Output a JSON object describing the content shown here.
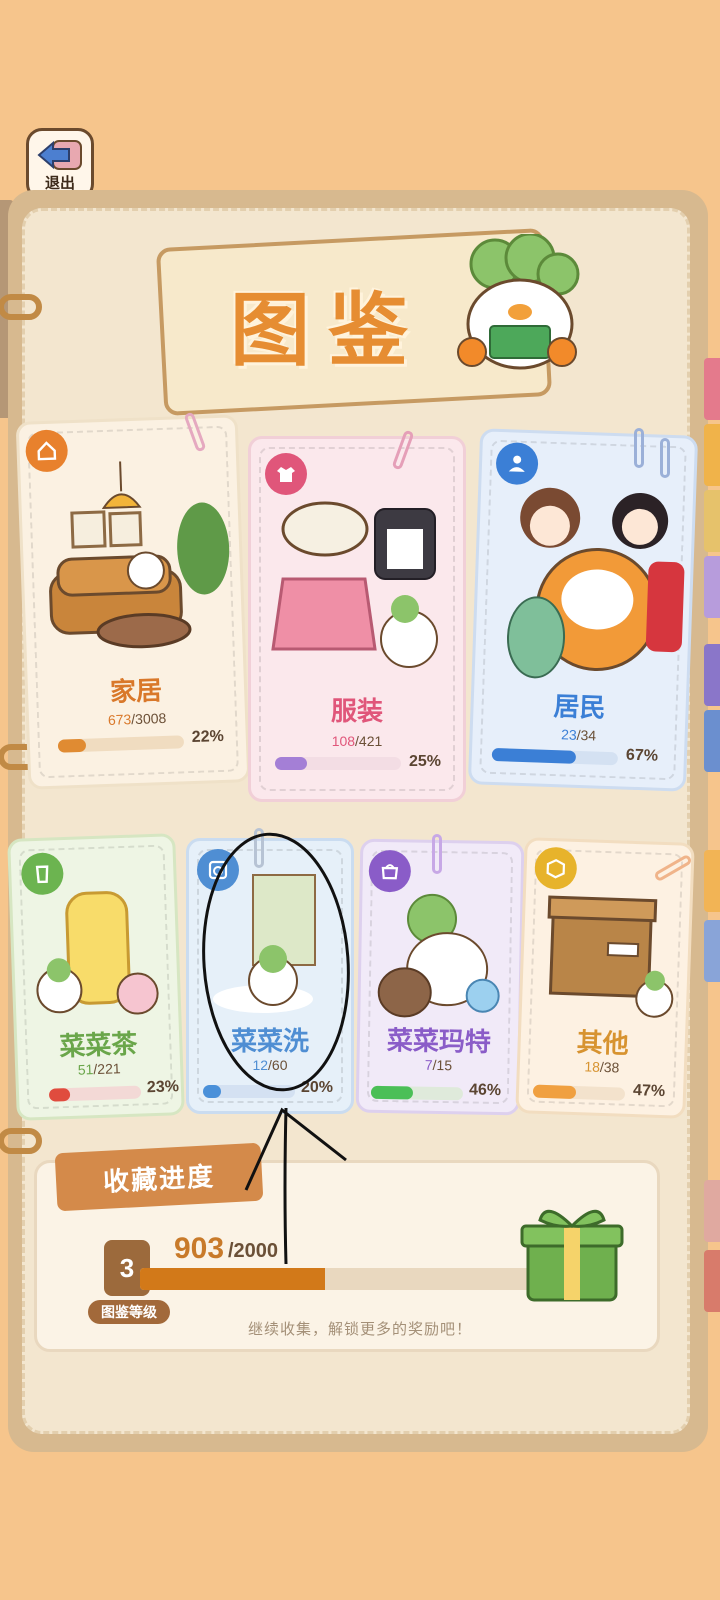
{
  "exit": {
    "label": "退出"
  },
  "title": "图鉴",
  "categories": [
    {
      "title": "家居",
      "current": "673",
      "total": "/3008",
      "percent": "22%",
      "fraction": 0.22,
      "icon": "house-icon",
      "accent": "#e8812d",
      "bar_color": "#e08b32"
    },
    {
      "title": "服装",
      "current": "108",
      "total": "/421",
      "percent": "25%",
      "fraction": 0.25,
      "icon": "shirt-icon",
      "accent": "#e0567a",
      "bar_color": "#a47fd6"
    },
    {
      "title": "居民",
      "current": "23",
      "total": "/34",
      "percent": "67%",
      "fraction": 0.67,
      "icon": "person-icon",
      "accent": "#3b7fd6",
      "bar_color": "#3b7fd6"
    },
    {
      "title": "菜菜茶",
      "current": "51",
      "total": "/221",
      "percent": "23%",
      "fraction": 0.23,
      "icon": "cup-icon",
      "accent": "#6cb450",
      "bar_color": "#e04c3e"
    },
    {
      "title": "菜菜洗",
      "current": "12",
      "total": "/60",
      "percent": "20%",
      "fraction": 0.2,
      "icon": "washer-icon",
      "accent": "#4f8ed3",
      "bar_color": "#4a90d9"
    },
    {
      "title": "菜菜玛特",
      "current": "7",
      "total": "/15",
      "percent": "46%",
      "fraction": 0.46,
      "icon": "shop-icon",
      "accent": "#8a5cc8",
      "bar_color": "#4bbf57"
    },
    {
      "title": "其他",
      "current": "18",
      "total": "/38",
      "percent": "47%",
      "fraction": 0.47,
      "icon": "box-icon",
      "accent": "#e7b32b",
      "bar_color": "#f0a040"
    }
  ],
  "progress": {
    "label": "收藏进度",
    "current": "903",
    "total": "/2000",
    "fraction": 0.4515,
    "level": "3",
    "level_label": "图鉴等级",
    "hint": "继续收集，解锁更多的奖励吧！"
  }
}
